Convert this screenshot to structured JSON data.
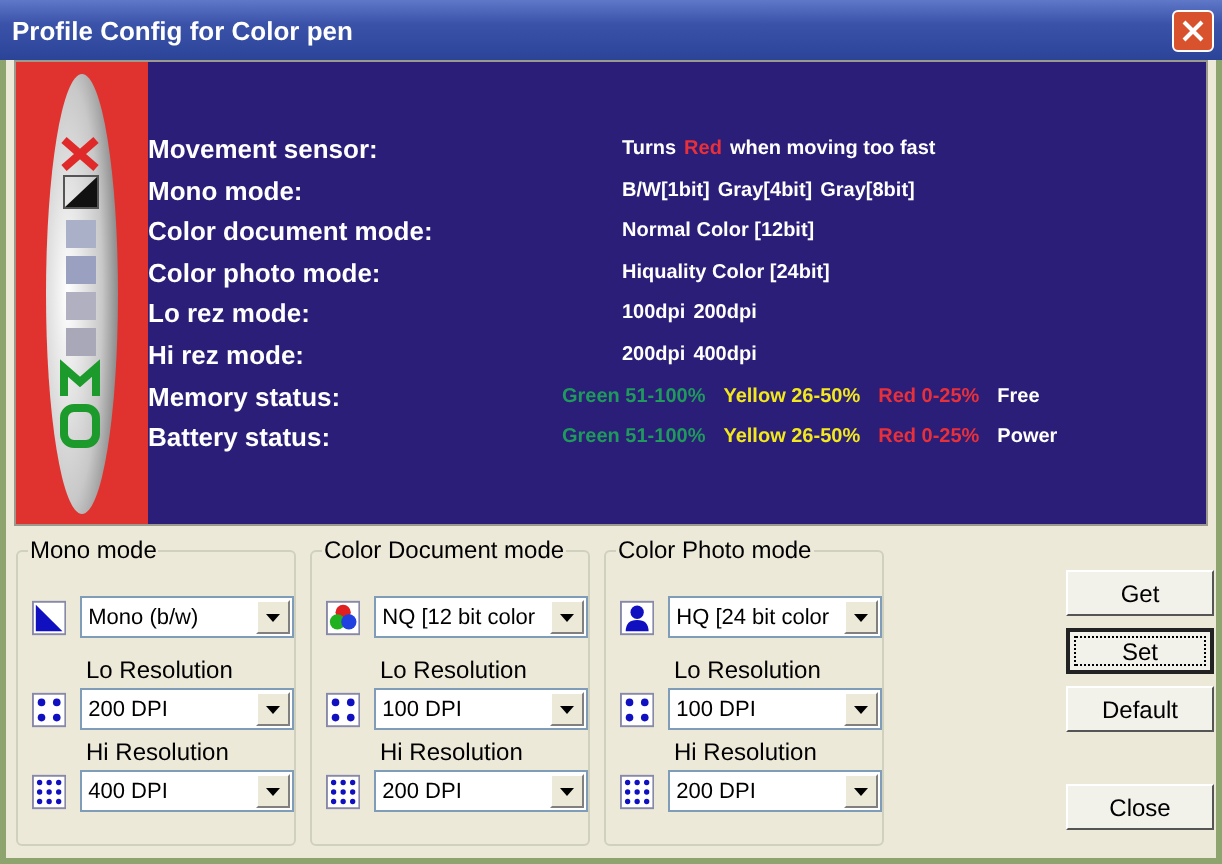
{
  "window": {
    "title": "Profile Config for Color pen"
  },
  "banner": {
    "rows": [
      {
        "label": "Movement sensor:",
        "kind": "plain",
        "parts": [
          {
            "text": "Turns",
            "color": "#ffffff"
          },
          {
            "text": "Red",
            "color": "#e8303a"
          },
          {
            "text": "when moving too fast",
            "color": "#ffffff"
          }
        ]
      },
      {
        "label": "Mono mode:",
        "kind": "plain",
        "parts": [
          {
            "text": "B/W[1bit]",
            "color": "#ffffff"
          },
          {
            "text": "Gray[4bit]",
            "color": "#ffffff"
          },
          {
            "text": "Gray[8bit]",
            "color": "#ffffff"
          }
        ]
      },
      {
        "label": "Color document mode:",
        "kind": "plain",
        "parts": [
          {
            "text": "Normal Color [12bit]",
            "color": "#ffffff"
          }
        ]
      },
      {
        "label": "Color photo mode:",
        "kind": "plain",
        "parts": [
          {
            "text": "Hiquality Color [24bit]",
            "color": "#ffffff"
          }
        ]
      },
      {
        "label": "Lo rez mode:",
        "kind": "plain",
        "parts": [
          {
            "text": "100dpi",
            "color": "#ffffff"
          },
          {
            "text": "200dpi",
            "color": "#ffffff"
          }
        ]
      },
      {
        "label": "Hi rez mode:",
        "kind": "plain",
        "parts": [
          {
            "text": "200dpi",
            "color": "#ffffff"
          },
          {
            "text": "400dpi",
            "color": "#ffffff"
          }
        ]
      },
      {
        "label": "Memory status:",
        "kind": "status",
        "parts": [
          {
            "text": "Green 51-100%",
            "color": "#1f9a5c"
          },
          {
            "text": "Yellow 26-50%",
            "color": "#f2e81c"
          },
          {
            "text": "Red 0-25%",
            "color": "#e8303a"
          },
          {
            "text": "Free",
            "color": "#ffffff"
          }
        ]
      },
      {
        "label": "Battery status:",
        "kind": "status",
        "parts": [
          {
            "text": "Green 51-100%",
            "color": "#1f9a5c"
          },
          {
            "text": "Yellow 26-50%",
            "color": "#f2e81c"
          },
          {
            "text": "Red 0-25%",
            "color": "#e8303a"
          },
          {
            "text": "Power",
            "color": "#ffffff"
          }
        ]
      }
    ]
  },
  "groups": [
    {
      "title": "Mono mode",
      "kind": "mono",
      "mode_value": "Mono (b/w)",
      "lo_label": "Lo Resolution",
      "lo_value": "200 DPI",
      "hi_label": "Hi Resolution",
      "hi_value": "400 DPI"
    },
    {
      "title": "Color Document mode",
      "kind": "document",
      "mode_value": "NQ [12 bit color",
      "lo_label": "Lo Resolution",
      "lo_value": "100 DPI",
      "hi_label": "Hi Resolution",
      "hi_value": "200 DPI"
    },
    {
      "title": "Color Photo mode",
      "kind": "photo",
      "mode_value": "HQ [24 bit color",
      "lo_label": "Lo Resolution",
      "lo_value": "100 DPI",
      "hi_label": "Hi Resolution",
      "hi_value": "200 DPI"
    }
  ],
  "buttons": [
    {
      "label": "Get",
      "focused": false
    },
    {
      "label": "Set",
      "focused": true
    },
    {
      "label": "Default",
      "focused": false
    },
    {
      "label": "Close",
      "focused": false
    }
  ]
}
